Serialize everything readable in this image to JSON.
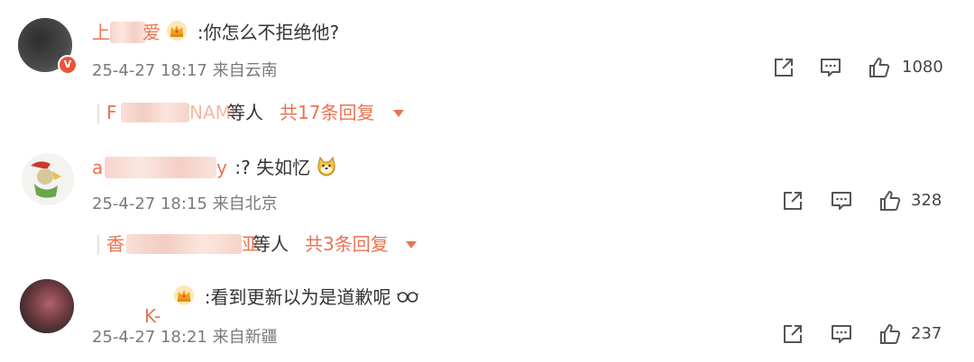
{
  "comments": [
    {
      "username_visible": "上",
      "username_suffix": "爱",
      "has_crown": true,
      "text": ":你怎么不拒绝他?",
      "timestamp": "25-4-27 18:17",
      "location": "来自云南",
      "likes": "1080",
      "replies": {
        "replier_visible": "F",
        "replier_suffix": "NAMI",
        "deng": "等人",
        "total": "共17条回复"
      }
    },
    {
      "username_visible": "a",
      "username_suffix": "y",
      "has_crown": false,
      "text": ":? 失如忆",
      "emoji_icon": "doge-icon",
      "timestamp": "25-4-27 18:15",
      "location": "来自北京",
      "likes": "328",
      "replies": {
        "replier_visible": "香",
        "replier_suffix": "亚",
        "deng": "等人",
        "total": "共3条回复"
      }
    },
    {
      "username_visible": "",
      "username_suffix": "K-",
      "has_crown": true,
      "text": ":看到更新以为是道歉呢",
      "emoji_icon": "glasses-icon",
      "timestamp": "25-4-27 18:21",
      "location": "来自新疆",
      "likes": "237"
    }
  ],
  "colors": {
    "username": "#eb7350",
    "meta": "#7a7a7a",
    "text": "#333333"
  },
  "icons": [
    "share-icon",
    "comment-icon",
    "like-icon",
    "crown-icon",
    "v-badge-icon",
    "caret-down-icon"
  ]
}
